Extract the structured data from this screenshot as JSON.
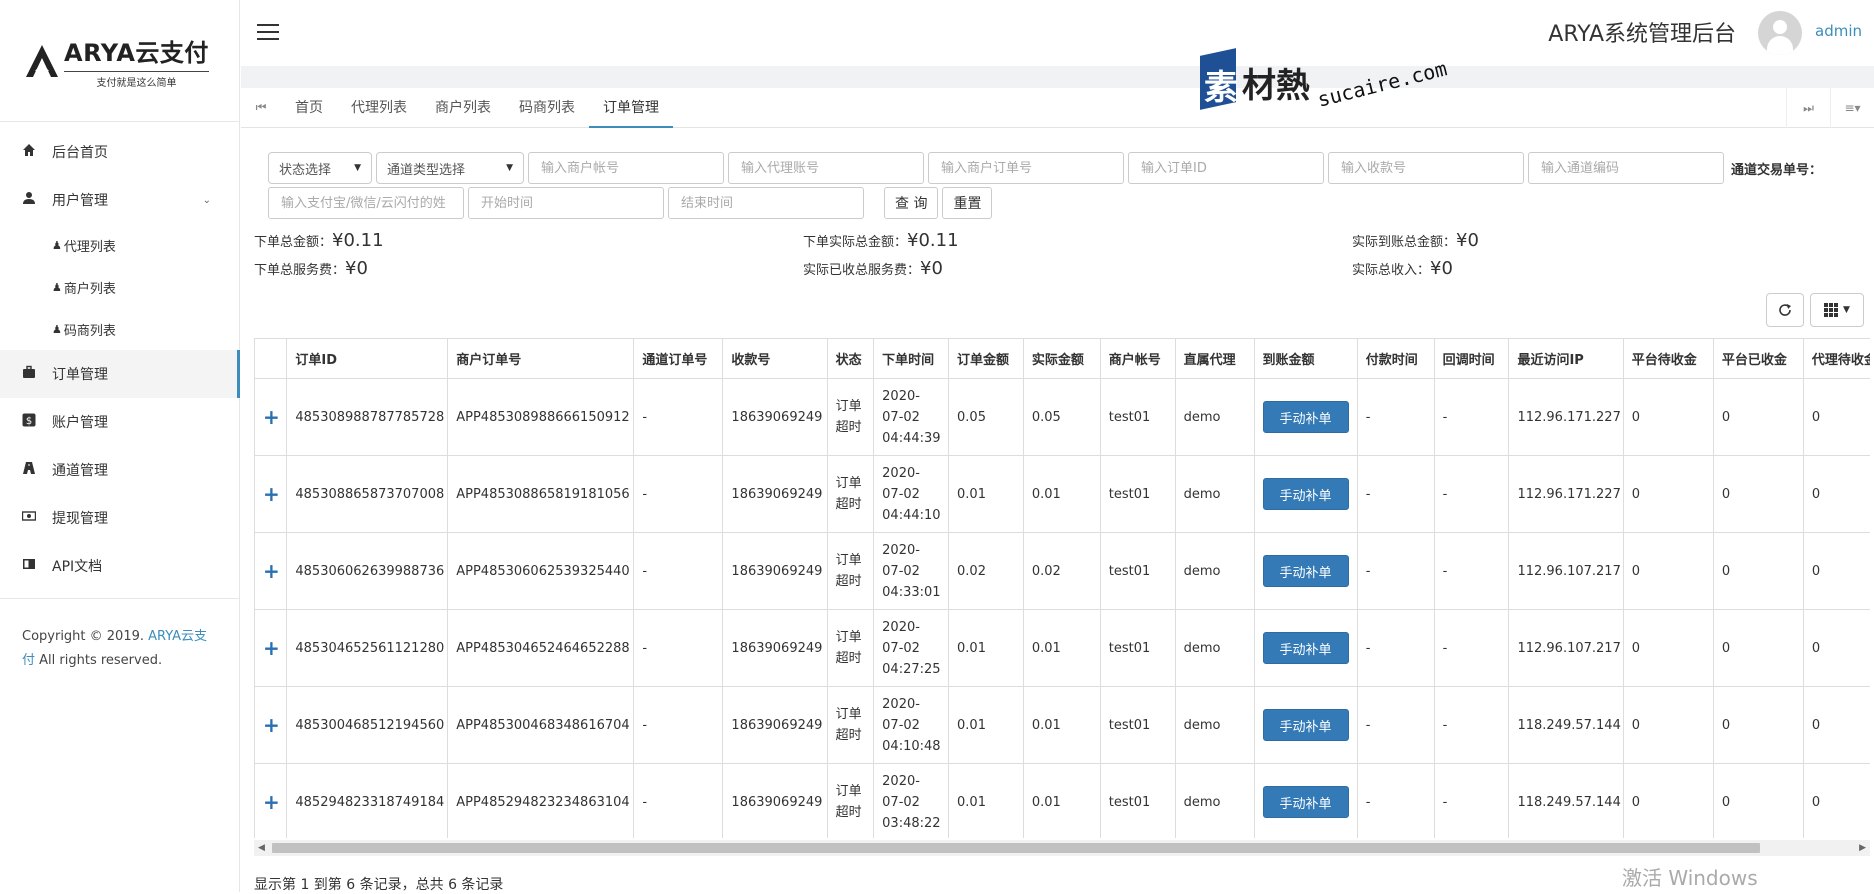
{
  "brand": {
    "logo_title": "ARYA云支付",
    "logo_sub": "支付就是这么简单"
  },
  "sidebar": {
    "items": [
      {
        "label": "后台首页",
        "icon": "home-icon"
      },
      {
        "label": "用户管理",
        "icon": "user-icon"
      },
      {
        "label": "订单管理",
        "icon": "briefcase-icon"
      },
      {
        "label": "账户管理",
        "icon": "dollar-icon"
      },
      {
        "label": "通道管理",
        "icon": "road-icon"
      },
      {
        "label": "提现管理",
        "icon": "money-icon"
      },
      {
        "label": "API文档",
        "icon": "book-icon"
      }
    ],
    "submenu": [
      {
        "label": "代理列表"
      },
      {
        "label": "商户列表"
      },
      {
        "label": "码商列表"
      }
    ],
    "copyright_prefix": "Copyright © 2019. ",
    "copyright_brand": "ARYA云支付",
    "copyright_suffix": " All rights reserved."
  },
  "header": {
    "system_title": "ARYA系统管理后台",
    "user": "admin"
  },
  "watermark": {
    "cn1": "素",
    "cn2": "材熱",
    "url": "sucaire.com"
  },
  "tabs": [
    {
      "label": "首页"
    },
    {
      "label": "代理列表"
    },
    {
      "label": "商户列表"
    },
    {
      "label": "码商列表"
    },
    {
      "label": "订单管理",
      "active": true
    }
  ],
  "filters": {
    "status_select": "状态选择",
    "channel_type_select": "通道类型选择",
    "merchant_account": "输入商户帐号",
    "agent_account": "输入代理账号",
    "merchant_order_no": "输入商户订单号",
    "order_id": "输入订单ID",
    "receive_no": "输入收款号",
    "channel_code": "输入通道编码",
    "channel_trade_label": "通道交易单号：",
    "payment_account": "输入支付宝/微信/云闪付的姓",
    "start_time": "开始时间",
    "end_time": "结束时间",
    "query_button": "查 询",
    "reset_button": "重置"
  },
  "summary": {
    "order_total_label": "下单总金额：",
    "order_total_value": "¥0.11",
    "actual_total_label": "下单实际总金额：",
    "actual_total_value": "¥0.11",
    "arrived_total_label": "实际到账总金额：",
    "arrived_total_value": "¥0",
    "service_fee_label": "下单总服务费：",
    "service_fee_value": "¥0",
    "received_fee_label": "实际已收总服务费：",
    "received_fee_value": "¥0",
    "income_label": "实际总收入：",
    "income_value": "¥0"
  },
  "table": {
    "headers": [
      "",
      "订单ID",
      "商户订单号",
      "通道订单号",
      "收款号",
      "状态",
      "下单时间",
      "订单金额",
      "实际金额",
      "商户帐号",
      "直属代理",
      "到账金额",
      "付款时间",
      "回调时间",
      "最近访问IP",
      "平台待收金",
      "平台已收金",
      "代理待收金"
    ],
    "action_label": "手动补单",
    "rows": [
      {
        "order_id": "485308988787785728",
        "merchant_order": "APP485308988666150912",
        "channel_order": "-",
        "receive_no": "18639069249",
        "status": "订单超时",
        "date": "2020-07-02",
        "time": "04:44:39",
        "amount": "0.05",
        "actual": "0.05",
        "merchant": "test01",
        "agent": "demo",
        "pay_time": "-",
        "callback_time": "-",
        "ip": "112.96.171.227",
        "p_pending": "0",
        "p_received": "0",
        "a_pending": "0"
      },
      {
        "order_id": "485308865873707008",
        "merchant_order": "APP485308865819181056",
        "channel_order": "-",
        "receive_no": "18639069249",
        "status": "订单超时",
        "date": "2020-07-02",
        "time": "04:44:10",
        "amount": "0.01",
        "actual": "0.01",
        "merchant": "test01",
        "agent": "demo",
        "pay_time": "-",
        "callback_time": "-",
        "ip": "112.96.171.227",
        "p_pending": "0",
        "p_received": "0",
        "a_pending": "0"
      },
      {
        "order_id": "485306062639988736",
        "merchant_order": "APP485306062539325440",
        "channel_order": "-",
        "receive_no": "18639069249",
        "status": "订单超时",
        "date": "2020-07-02",
        "time": "04:33:01",
        "amount": "0.02",
        "actual": "0.02",
        "merchant": "test01",
        "agent": "demo",
        "pay_time": "-",
        "callback_time": "-",
        "ip": "112.96.107.217",
        "p_pending": "0",
        "p_received": "0",
        "a_pending": "0"
      },
      {
        "order_id": "485304652561121280",
        "merchant_order": "APP485304652464652288",
        "channel_order": "-",
        "receive_no": "18639069249",
        "status": "订单超时",
        "date": "2020-07-02",
        "time": "04:27:25",
        "amount": "0.01",
        "actual": "0.01",
        "merchant": "test01",
        "agent": "demo",
        "pay_time": "-",
        "callback_time": "-",
        "ip": "112.96.107.217",
        "p_pending": "0",
        "p_received": "0",
        "a_pending": "0"
      },
      {
        "order_id": "485300468512194560",
        "merchant_order": "APP485300468348616704",
        "channel_order": "-",
        "receive_no": "18639069249",
        "status": "订单超时",
        "date": "2020-07-02",
        "time": "04:10:48",
        "amount": "0.01",
        "actual": "0.01",
        "merchant": "test01",
        "agent": "demo",
        "pay_time": "-",
        "callback_time": "-",
        "ip": "118.249.57.144",
        "p_pending": "0",
        "p_received": "0",
        "a_pending": "0"
      },
      {
        "order_id": "485294823318749184",
        "merchant_order": "APP485294823234863104",
        "channel_order": "-",
        "receive_no": "18639069249",
        "status": "订单超时",
        "date": "2020-07-02",
        "time": "03:48:22",
        "amount": "0.01",
        "actual": "0.01",
        "merchant": "test01",
        "agent": "demo",
        "pay_time": "-",
        "callback_time": "-",
        "ip": "118.249.57.144",
        "p_pending": "0",
        "p_received": "0",
        "a_pending": "0"
      }
    ]
  },
  "pagination": {
    "info": "显示第 1 到第 6 条记录，总共 6 条记录"
  },
  "os_overlay": {
    "activate": "激活 Windows"
  },
  "colors": {
    "accent": "#3c8dbc",
    "primary_button": "#337ab7",
    "plus": "#2a6fb0"
  }
}
